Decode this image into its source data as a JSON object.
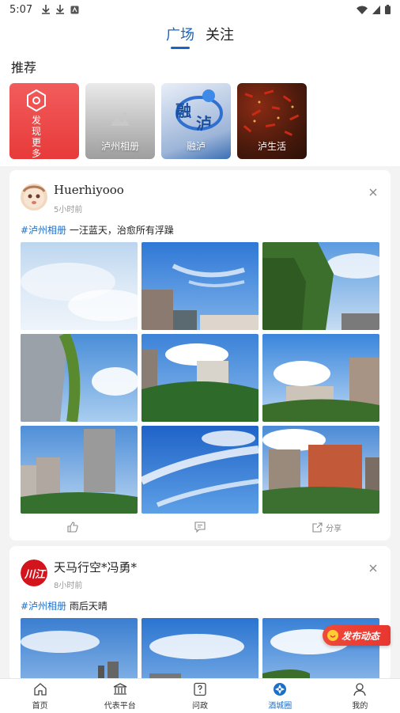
{
  "status_bar": {
    "time": "5:07"
  },
  "tabs": [
    {
      "label": "广场",
      "active": true
    },
    {
      "label": "关注",
      "active": false
    }
  ],
  "recommend": {
    "title": "推荐",
    "cards": [
      {
        "label": "发现更多"
      },
      {
        "label": "泸州相册"
      },
      {
        "label": "融泸"
      },
      {
        "label": "泸生活"
      }
    ]
  },
  "posts": [
    {
      "author": "Huerhiyooo",
      "time": "5小时前",
      "tag": "#泸州相册",
      "text": " 一汪蓝天，治愈所有浮躁",
      "actions": {
        "share": "分享"
      }
    },
    {
      "author": "天马行空*冯勇*",
      "time": "8小时前",
      "tag": "#泸州相册",
      "text": " 雨后天晴"
    }
  ],
  "fab": {
    "label": "发布动态"
  },
  "bottom_nav": [
    {
      "label": "首页",
      "icon": "home-icon",
      "active": false
    },
    {
      "label": "代表平台",
      "icon": "hall-icon",
      "active": false
    },
    {
      "label": "问政",
      "icon": "question-icon",
      "active": false
    },
    {
      "label": "酒城圈",
      "icon": "circle-icon",
      "active": true
    },
    {
      "label": "我的",
      "icon": "user-icon",
      "active": false
    }
  ],
  "colors": {
    "accent": "#1d6fc8",
    "fab": "#e8362f"
  }
}
